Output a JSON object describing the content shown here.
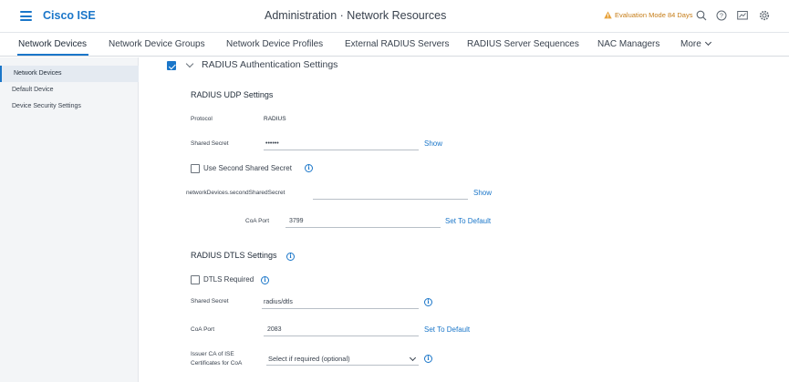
{
  "header": {
    "brand": "Cisco ISE",
    "title": "Administration · Network Resources",
    "eval_text": "Evaluation Mode 84 Days",
    "icons": [
      "search-icon",
      "help-icon",
      "dashboard-icon",
      "gear-icon"
    ]
  },
  "tabs": [
    {
      "label": "Network Devices"
    },
    {
      "label": "Network Device Groups"
    },
    {
      "label": "Network Device Profiles"
    },
    {
      "label": "External RADIUS Servers"
    },
    {
      "label": "RADIUS Server Sequences"
    },
    {
      "label": "NAC Managers"
    },
    {
      "label": "More"
    }
  ],
  "sidebar": {
    "items": [
      {
        "label": "Network Devices"
      },
      {
        "label": "Default Device"
      },
      {
        "label": "Device Security Settings"
      }
    ]
  },
  "form": {
    "section_title": "RADIUS Authentication Settings",
    "udp": {
      "title": "RADIUS UDP Settings",
      "protocol_label": "Protocol",
      "protocol_value": "RADIUS",
      "shared_secret_label": "Shared Secret",
      "shared_secret_value": "••••••",
      "show_label": "Show",
      "second_secret_label": "Use Second Shared Secret",
      "second_secret_field_label": "networkDevices.secondSharedSecret",
      "second_secret_value": "",
      "show2_label": "Show",
      "coa_port_label": "CoA Port",
      "coa_port_value": "3799",
      "set_default_label": "Set To Default"
    },
    "dtls": {
      "title": "RADIUS DTLS Settings",
      "required_label": "DTLS Required",
      "shared_secret_label": "Shared Secret",
      "shared_secret_value": "radius/dtls",
      "coa_port_label": "CoA Port",
      "coa_port_value": "2083",
      "set_default_label": "Set To Default",
      "issuer_label_1": "Issuer CA of ISE",
      "issuer_label_2": "Certificates for CoA",
      "issuer_value": "Select if required (optional)"
    }
  },
  "colors": {
    "accent": "#1a76c9",
    "warning": "#c67c16"
  }
}
